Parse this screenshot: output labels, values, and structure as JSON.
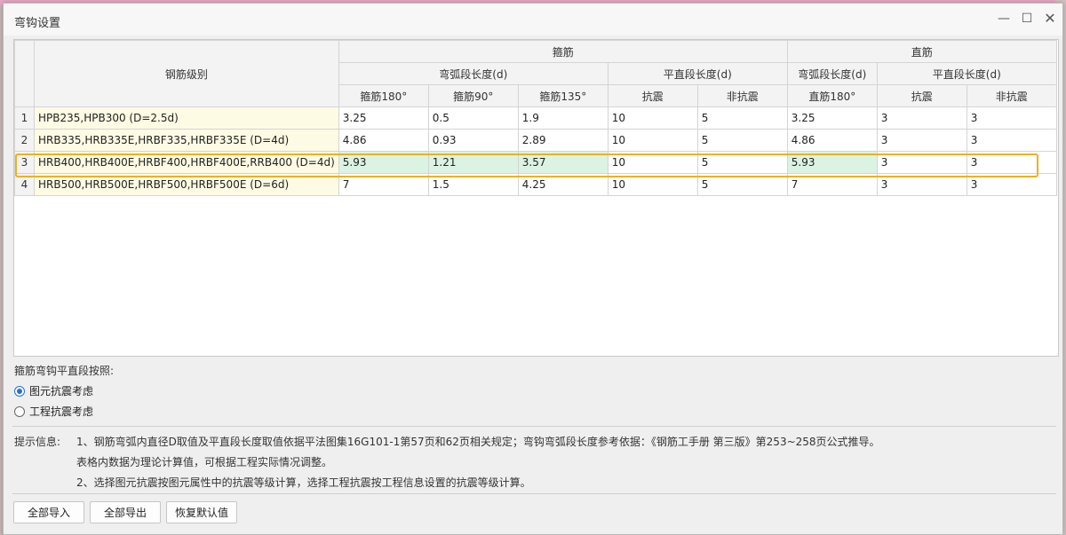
{
  "dialog": {
    "title": "弯钩设置",
    "min_glyph": "—",
    "max_glyph": "☐",
    "close_glyph": "✕"
  },
  "grid": {
    "header": {
      "grade": "钢筋级别",
      "stirrup": "箍筋",
      "straight": "直筋",
      "stirrup_arc": "弯弧段长度(d)",
      "stirrup_flat": "平直段长度(d)",
      "straight_arc": "弯弧段长度(d)",
      "straight_flat": "平直段长度(d)",
      "c180": "箍筋180°",
      "c90": "箍筋90°",
      "c135": "箍筋135°",
      "seismic": "抗震",
      "nonseismic": "非抗震",
      "s180": "直筋180°",
      "s_seismic": "抗震",
      "s_nonseismic": "非抗震"
    },
    "rows": [
      {
        "num": "1",
        "grade": "HPB235,HPB300 (D=2.5d)",
        "c180": "3.25",
        "c90": "0.5",
        "c135": "1.9",
        "seismic": "10",
        "nonseismic": "5",
        "s180": "3.25",
        "s_seismic": "3",
        "s_nonseismic": "3"
      },
      {
        "num": "2",
        "grade": "HRB335,HRB335E,HRBF335,HRBF335E (D=4d)",
        "c180": "4.86",
        "c90": "0.93",
        "c135": "2.89",
        "seismic": "10",
        "nonseismic": "5",
        "s180": "4.86",
        "s_seismic": "3",
        "s_nonseismic": "3"
      },
      {
        "num": "3",
        "grade": "HRB400,HRB400E,HRBF400,HRBF400E,RRB400 (D=4d)",
        "c180": "5.93",
        "c90": "1.21",
        "c135": "3.57",
        "seismic": "10",
        "nonseismic": "5",
        "s180": "5.93",
        "s_seismic": "3",
        "s_nonseismic": "3"
      },
      {
        "num": "4",
        "grade": "HRB500,HRB500E,HRBF500,HRBF500E (D=6d)",
        "c180": "7",
        "c90": "1.5",
        "c135": "4.25",
        "seismic": "10",
        "nonseismic": "5",
        "s180": "7",
        "s_seismic": "3",
        "s_nonseismic": "3"
      }
    ]
  },
  "options": {
    "label": "箍筋弯钩平直段按照:",
    "radio1": "图元抗震考虑",
    "radio2": "工程抗震考虑",
    "selected": "radio1"
  },
  "tips": {
    "label": "提示信息:",
    "line1": "1、钢筋弯弧内直径D取值及平直段长度取值依据平法图集16G101-1第57页和62页相关规定；弯钩弯弧段长度参考依据：《钢筋工手册  第三版》第253~258页公式推导。",
    "line2": "表格内数据为理论计算值，可根据工程实际情况调整。",
    "line3": "2、选择图元抗震按图元属性中的抗震等级计算，选择工程抗震按工程信息设置的抗震等级计算。"
  },
  "buttons": {
    "import_all": "全部导入",
    "export_all": "全部导出",
    "restore_default": "恢复默认值"
  },
  "colors": {
    "highlight": "#f0b020",
    "selected_cell": "#dbf3e3",
    "grade_cell": "#fdfbe4",
    "radio_accent": "#2a6fd6"
  }
}
